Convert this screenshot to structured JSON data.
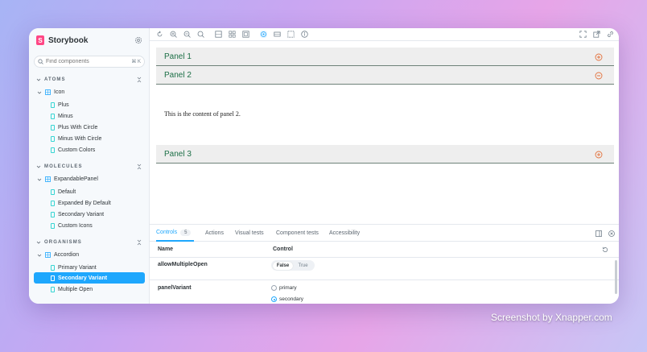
{
  "sidebar": {
    "brand": "Storybook",
    "search_placeholder": "Find components",
    "search_shortcut": "⌘ K",
    "sections": [
      {
        "title": "ATOMS",
        "component": "Icon",
        "stories": [
          "Plus",
          "Minus",
          "Plus With Circle",
          "Minus With Circle",
          "Custom Colors"
        ]
      },
      {
        "title": "MOLECULES",
        "component": "ExpandablePanel",
        "stories": [
          "Default",
          "Expanded By Default",
          "Secondary Variant",
          "Custom Icons"
        ]
      },
      {
        "title": "ORGANISMS",
        "component": "Accordion",
        "stories": [
          "Primary Variant",
          "Secondary Variant",
          "Multiple Open"
        ]
      }
    ],
    "selected_story": "Secondary Variant"
  },
  "preview": {
    "panels": [
      {
        "title": "Panel 1",
        "state": "collapsed"
      },
      {
        "title": "Panel 2",
        "state": "expanded"
      },
      {
        "title": "Panel 3",
        "state": "collapsed"
      }
    ],
    "panel2_content": "This is the content of panel 2."
  },
  "addons": {
    "tabs": [
      {
        "label": "Controls",
        "count": "5"
      },
      {
        "label": "Actions"
      },
      {
        "label": "Visual tests"
      },
      {
        "label": "Component tests"
      },
      {
        "label": "Accessibility"
      }
    ],
    "table": {
      "header_name": "Name",
      "header_control": "Control",
      "rows": [
        {
          "name": "allowMultipleOpen",
          "options": [
            "False",
            "True"
          ],
          "selected": "False"
        },
        {
          "name": "panelVariant",
          "options": [
            "primary",
            "secondary"
          ],
          "selected": "secondary"
        }
      ]
    }
  },
  "colors": {
    "accent": "#1ea7fd",
    "brand": "#ff4785",
    "panel_title": "#1c6f46",
    "panel_icon": "#e3723d"
  },
  "watermark": "Screenshot by Xnapper.com"
}
